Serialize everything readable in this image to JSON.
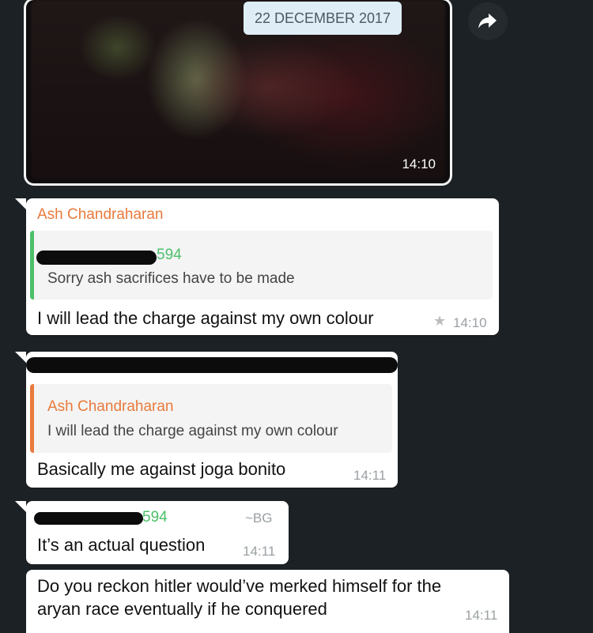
{
  "media": {
    "date_chip": "22 DECEMBER 2017",
    "time": "14:10",
    "forward_icon": "forward-arrow-icon"
  },
  "messages": [
    {
      "sender": "Ash Chandraharan",
      "sender_color": "#e87a3c",
      "quote": {
        "author_suffix": "594",
        "author_color": "#4cbf6a",
        "text": "Sorry ash sacrifices have to be made"
      },
      "text": "I will lead the charge against my own colour",
      "starred": true,
      "time": "14:10"
    },
    {
      "quote": {
        "author": "Ash Chandraharan",
        "author_color": "#e87a3c",
        "text": "I will lead the charge against my own colour"
      },
      "text": "Basically me against joga bonito",
      "time": "14:11"
    },
    {
      "sender_suffix": "594",
      "sender_color": "#4cbf6a",
      "push_name": "~BG",
      "text": "It’s an actual question",
      "time": "14:11"
    },
    {
      "text_line1": "Do you reckon hitler would’ve merked himself for the",
      "text_line2": "aryan race eventually if he conquered",
      "time": "14:11"
    }
  ]
}
